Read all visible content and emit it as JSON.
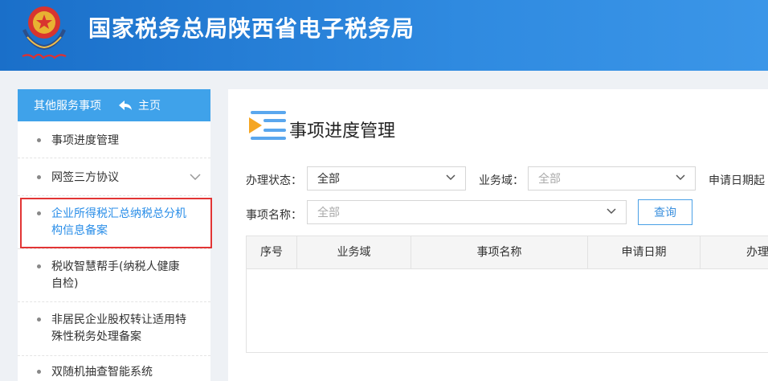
{
  "header": {
    "title": "国家税务总局陕西省电子税务局"
  },
  "sidebar": {
    "title": "其他服务事项",
    "home_label": "主页",
    "items": [
      {
        "label": "事项进度管理"
      },
      {
        "label": "网签三方协议"
      },
      {
        "label": "企业所得税汇总纳税总分机构信息备案"
      },
      {
        "label": "税收智慧帮手(纳税人健康自检)"
      },
      {
        "label": "非居民企业股权转让适用特殊性税务处理备案"
      },
      {
        "label": "双随机抽查智能系统"
      }
    ]
  },
  "main": {
    "title": "事项进度管理",
    "filters": {
      "status_label": "办理状态：",
      "status_value": "全部",
      "domain_label": "业务域：",
      "domain_placeholder": "全部",
      "date_label": "申请日期起",
      "name_label": "事项名称：",
      "name_placeholder": "全部",
      "query_label": "查询"
    },
    "table": {
      "columns": [
        "序号",
        "业务域",
        "事项名称",
        "申请日期",
        "办理"
      ]
    }
  },
  "colors": {
    "header_blue": "#2f8ae0",
    "sidebar_head": "#3fa2ea",
    "active_link": "#2a8ee8",
    "highlight_red": "#e23535"
  }
}
